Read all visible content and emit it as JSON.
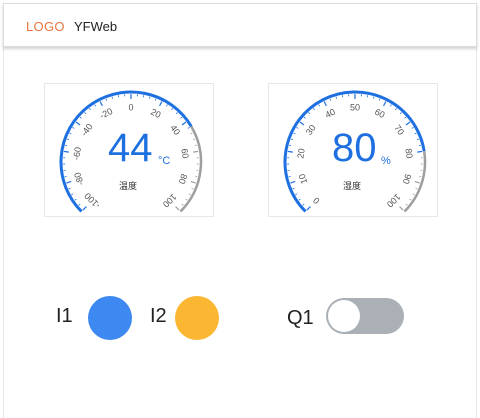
{
  "header": {
    "logo": "LOGO",
    "app_name": "YFWeb"
  },
  "gauges": [
    {
      "name": "温度",
      "value": "44",
      "unit": "°C",
      "min": -100,
      "max": 100,
      "ticks": [
        "-100",
        "-80",
        "-60",
        "-40",
        "-20",
        "0",
        "20",
        "40",
        "60",
        "80",
        "100"
      ],
      "accent": "#1e6fe0"
    },
    {
      "name": "湿度",
      "value": "80",
      "unit": "%",
      "min": 0,
      "max": 100,
      "ticks": [
        "0",
        "10",
        "20",
        "30",
        "40",
        "50",
        "60",
        "70",
        "80",
        "90",
        "100"
      ],
      "accent": "#1e6fe0"
    }
  ],
  "inputs": [
    {
      "label": "I1",
      "color": "#3e88f2"
    },
    {
      "label": "I2",
      "color": "#fbb731"
    }
  ],
  "output": {
    "label": "Q1",
    "state": "off",
    "track_color": "#aab0b5"
  }
}
